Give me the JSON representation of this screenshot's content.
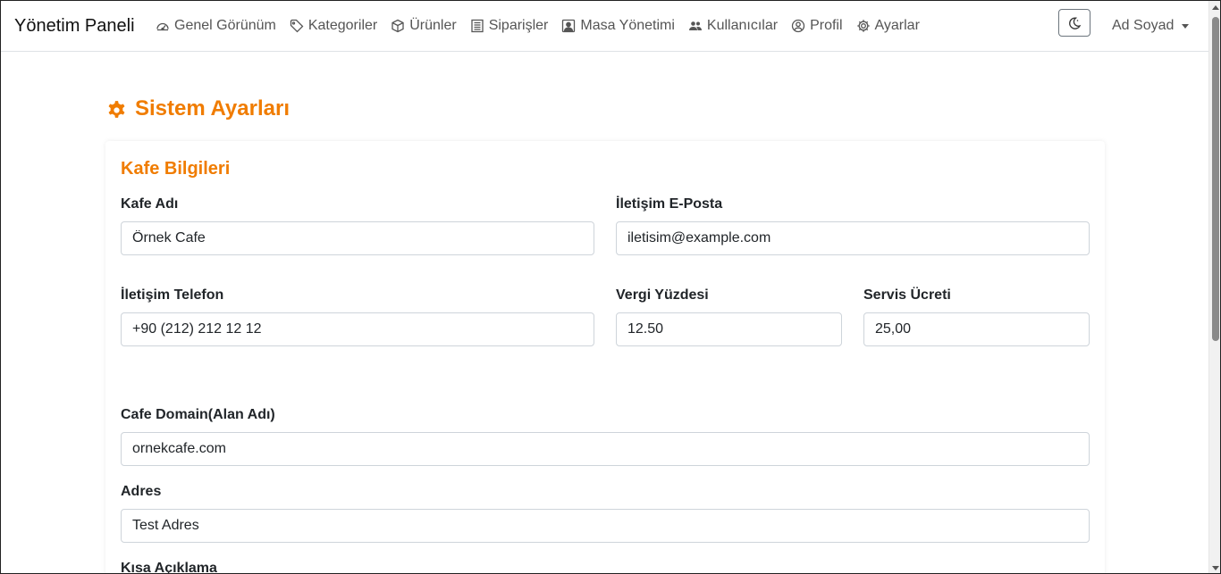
{
  "navbar": {
    "brand": "Yönetim Paneli",
    "items": [
      {
        "label": "Genel Görünüm",
        "icon": "dashboard-gauge-icon"
      },
      {
        "label": "Kategoriler",
        "icon": "tag-icon"
      },
      {
        "label": "Ürünler",
        "icon": "box-icon"
      },
      {
        "label": "Siparişler",
        "icon": "list-document-icon"
      },
      {
        "label": "Masa Yönetimi",
        "icon": "person-badge-icon"
      },
      {
        "label": "Kullanıcılar",
        "icon": "people-icon"
      },
      {
        "label": "Profil",
        "icon": "user-circle-icon"
      },
      {
        "label": "Ayarlar",
        "icon": "gear-icon"
      }
    ],
    "theme_toggle_icon": "moon-icon",
    "user_name": "Ad Soyad"
  },
  "page": {
    "title": "Sistem Ayarları",
    "title_icon": "gear-icon",
    "accent_color": "#f07c00"
  },
  "form": {
    "section_title": "Kafe Bilgileri",
    "cafe_name": {
      "label": "Kafe Adı",
      "value": "Örnek Cafe"
    },
    "email": {
      "label": "İletişim E-Posta",
      "value": "iletisim@example.com"
    },
    "phone": {
      "label": "İletişim Telefon",
      "value": "+90 (212) 212 12 12"
    },
    "tax": {
      "label": "Vergi Yüzdesi",
      "value": "12.50"
    },
    "service_fee": {
      "label": "Servis Ücreti",
      "value": "25,00"
    },
    "domain": {
      "label": "Cafe Domain(Alan Adı)",
      "value": "ornekcafe.com"
    },
    "address": {
      "label": "Adres",
      "value": "Test Adres"
    },
    "short_description": {
      "label": "Kısa Açıklama"
    }
  }
}
